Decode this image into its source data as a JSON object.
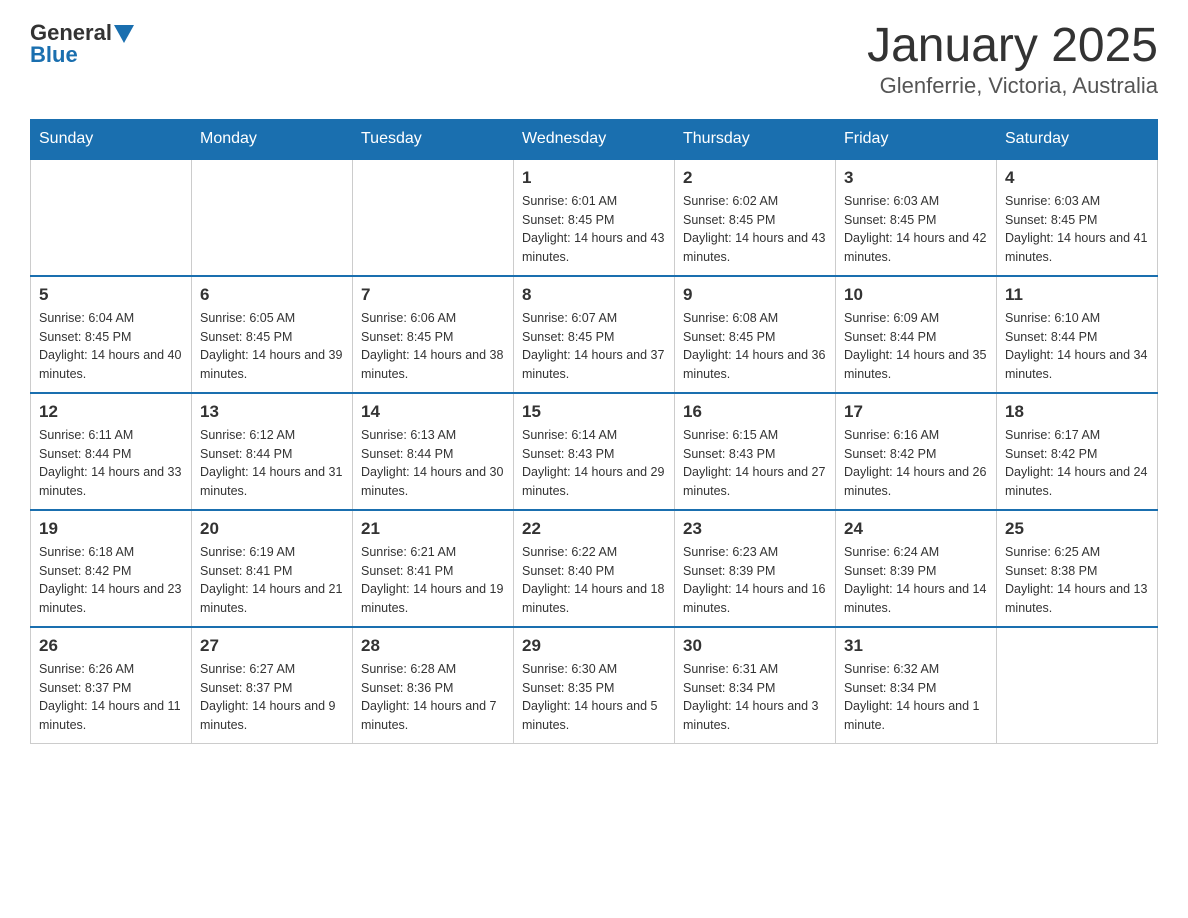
{
  "header": {
    "logo": {
      "general": "General",
      "blue": "Blue"
    },
    "title": "January 2025",
    "subtitle": "Glenferrie, Victoria, Australia"
  },
  "weekdays": [
    "Sunday",
    "Monday",
    "Tuesday",
    "Wednesday",
    "Thursday",
    "Friday",
    "Saturday"
  ],
  "weeks": [
    [
      {
        "day": null
      },
      {
        "day": null
      },
      {
        "day": null
      },
      {
        "day": 1,
        "sunrise": "6:01 AM",
        "sunset": "8:45 PM",
        "daylight": "14 hours and 43 minutes."
      },
      {
        "day": 2,
        "sunrise": "6:02 AM",
        "sunset": "8:45 PM",
        "daylight": "14 hours and 43 minutes."
      },
      {
        "day": 3,
        "sunrise": "6:03 AM",
        "sunset": "8:45 PM",
        "daylight": "14 hours and 42 minutes."
      },
      {
        "day": 4,
        "sunrise": "6:03 AM",
        "sunset": "8:45 PM",
        "daylight": "14 hours and 41 minutes."
      }
    ],
    [
      {
        "day": 5,
        "sunrise": "6:04 AM",
        "sunset": "8:45 PM",
        "daylight": "14 hours and 40 minutes."
      },
      {
        "day": 6,
        "sunrise": "6:05 AM",
        "sunset": "8:45 PM",
        "daylight": "14 hours and 39 minutes."
      },
      {
        "day": 7,
        "sunrise": "6:06 AM",
        "sunset": "8:45 PM",
        "daylight": "14 hours and 38 minutes."
      },
      {
        "day": 8,
        "sunrise": "6:07 AM",
        "sunset": "8:45 PM",
        "daylight": "14 hours and 37 minutes."
      },
      {
        "day": 9,
        "sunrise": "6:08 AM",
        "sunset": "8:45 PM",
        "daylight": "14 hours and 36 minutes."
      },
      {
        "day": 10,
        "sunrise": "6:09 AM",
        "sunset": "8:44 PM",
        "daylight": "14 hours and 35 minutes."
      },
      {
        "day": 11,
        "sunrise": "6:10 AM",
        "sunset": "8:44 PM",
        "daylight": "14 hours and 34 minutes."
      }
    ],
    [
      {
        "day": 12,
        "sunrise": "6:11 AM",
        "sunset": "8:44 PM",
        "daylight": "14 hours and 33 minutes."
      },
      {
        "day": 13,
        "sunrise": "6:12 AM",
        "sunset": "8:44 PM",
        "daylight": "14 hours and 31 minutes."
      },
      {
        "day": 14,
        "sunrise": "6:13 AM",
        "sunset": "8:44 PM",
        "daylight": "14 hours and 30 minutes."
      },
      {
        "day": 15,
        "sunrise": "6:14 AM",
        "sunset": "8:43 PM",
        "daylight": "14 hours and 29 minutes."
      },
      {
        "day": 16,
        "sunrise": "6:15 AM",
        "sunset": "8:43 PM",
        "daylight": "14 hours and 27 minutes."
      },
      {
        "day": 17,
        "sunrise": "6:16 AM",
        "sunset": "8:42 PM",
        "daylight": "14 hours and 26 minutes."
      },
      {
        "day": 18,
        "sunrise": "6:17 AM",
        "sunset": "8:42 PM",
        "daylight": "14 hours and 24 minutes."
      }
    ],
    [
      {
        "day": 19,
        "sunrise": "6:18 AM",
        "sunset": "8:42 PM",
        "daylight": "14 hours and 23 minutes."
      },
      {
        "day": 20,
        "sunrise": "6:19 AM",
        "sunset": "8:41 PM",
        "daylight": "14 hours and 21 minutes."
      },
      {
        "day": 21,
        "sunrise": "6:21 AM",
        "sunset": "8:41 PM",
        "daylight": "14 hours and 19 minutes."
      },
      {
        "day": 22,
        "sunrise": "6:22 AM",
        "sunset": "8:40 PM",
        "daylight": "14 hours and 18 minutes."
      },
      {
        "day": 23,
        "sunrise": "6:23 AM",
        "sunset": "8:39 PM",
        "daylight": "14 hours and 16 minutes."
      },
      {
        "day": 24,
        "sunrise": "6:24 AM",
        "sunset": "8:39 PM",
        "daylight": "14 hours and 14 minutes."
      },
      {
        "day": 25,
        "sunrise": "6:25 AM",
        "sunset": "8:38 PM",
        "daylight": "14 hours and 13 minutes."
      }
    ],
    [
      {
        "day": 26,
        "sunrise": "6:26 AM",
        "sunset": "8:37 PM",
        "daylight": "14 hours and 11 minutes."
      },
      {
        "day": 27,
        "sunrise": "6:27 AM",
        "sunset": "8:37 PM",
        "daylight": "14 hours and 9 minutes."
      },
      {
        "day": 28,
        "sunrise": "6:28 AM",
        "sunset": "8:36 PM",
        "daylight": "14 hours and 7 minutes."
      },
      {
        "day": 29,
        "sunrise": "6:30 AM",
        "sunset": "8:35 PM",
        "daylight": "14 hours and 5 minutes."
      },
      {
        "day": 30,
        "sunrise": "6:31 AM",
        "sunset": "8:34 PM",
        "daylight": "14 hours and 3 minutes."
      },
      {
        "day": 31,
        "sunrise": "6:32 AM",
        "sunset": "8:34 PM",
        "daylight": "14 hours and 1 minute."
      },
      {
        "day": null
      }
    ]
  ]
}
